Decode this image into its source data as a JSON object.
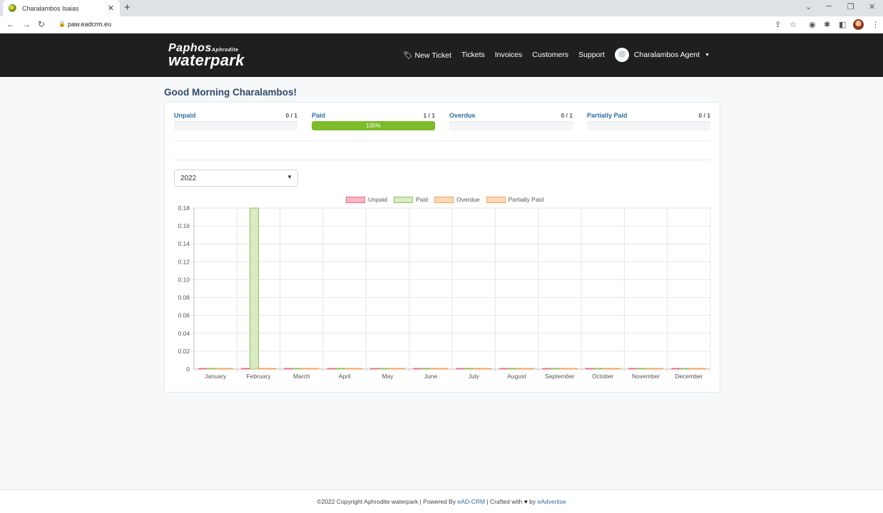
{
  "browser": {
    "tab_title": "Charalambos Isaias",
    "new_tab": "+",
    "url": "paw.eadcrm.eu"
  },
  "navbar": {
    "logo_line1": "Paphos",
    "logo_small": "Aphrodite",
    "logo_line2": "waterpark",
    "links": {
      "new_ticket": "New Ticket",
      "tickets": "Tickets",
      "invoices": "Invoices",
      "customers": "Customers",
      "support": "Support"
    },
    "user_name": "Charalambos Agent"
  },
  "greeting": "Good Morning Charalambos!",
  "stats": [
    {
      "label": "Unpaid",
      "count": "0 / 1",
      "progress": 0,
      "text": ""
    },
    {
      "label": "Paid",
      "count": "1 / 1",
      "progress": 100,
      "text": "100%"
    },
    {
      "label": "Overdue",
      "count": "0 / 1",
      "progress": 0,
      "text": ""
    },
    {
      "label": "Partially Paid",
      "count": "0 / 1",
      "progress": 0,
      "text": ""
    }
  ],
  "year_filter": {
    "selected": "2022"
  },
  "colors": {
    "navbar_bg": "#1f1f1f",
    "accent": "#2e6da4",
    "paid_bar": "#7cbb2a"
  },
  "chart_data": {
    "type": "bar",
    "categories": [
      "January",
      "February",
      "March",
      "April",
      "May",
      "June",
      "July",
      "August",
      "September",
      "October",
      "November",
      "December"
    ],
    "series": [
      {
        "name": "Unpaid",
        "values": [
          0,
          0,
          0,
          0,
          0,
          0,
          0,
          0,
          0,
          0,
          0,
          0
        ],
        "fill": "#f7b6c3",
        "stroke": "#ef6b86"
      },
      {
        "name": "Paid",
        "values": [
          0,
          1,
          0,
          0,
          0,
          0,
          0,
          0,
          0,
          0,
          0,
          0
        ],
        "fill": "#d8ebc2",
        "stroke": "#8cc35a"
      },
      {
        "name": "Overdue",
        "values": [
          0,
          0,
          0,
          0,
          0,
          0,
          0,
          0,
          0,
          0,
          0,
          0
        ],
        "fill": "#fcd9b8",
        "stroke": "#f5a35c"
      },
      {
        "name": "Partially Paid",
        "values": [
          0,
          0,
          0,
          0,
          0,
          0,
          0,
          0,
          0,
          0,
          0,
          0
        ],
        "fill": "#fcd9b8",
        "stroke": "#f5a35c"
      }
    ],
    "y_ticks": [
      "0",
      "0.02",
      "0.04",
      "0.06",
      "0.08",
      "0.10",
      "0.12",
      "0.14",
      "0.16",
      "0.18"
    ],
    "ylim": [
      0,
      0.18
    ],
    "grid": true,
    "legend_position": "top"
  },
  "footer": {
    "copyright": "©2022 Copyright Aphrodite waterpark | Powered By ",
    "crm_link": "eAD-CRM",
    "crafted": " | Crafted with ",
    "heart": "♥",
    "by": " by ",
    "agency_link": "eAdvertise"
  }
}
